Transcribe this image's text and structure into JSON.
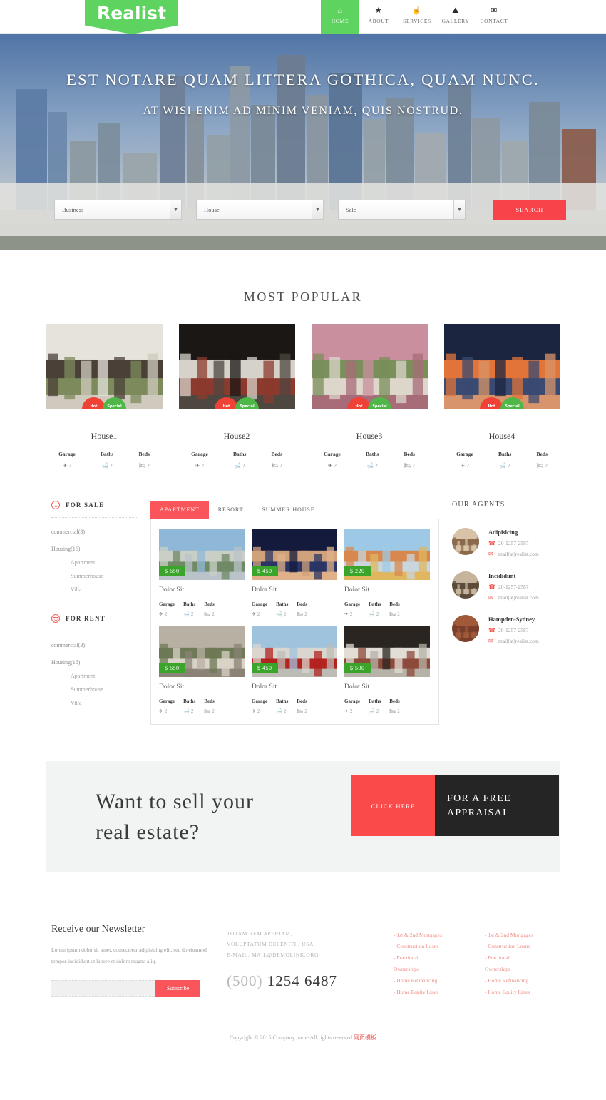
{
  "brand": {
    "name": "Realist",
    "color": "#5fd35f"
  },
  "nav": {
    "items": [
      {
        "label": "HOME",
        "icon": "home-icon",
        "glyph": "⌂",
        "active": true
      },
      {
        "label": "ABOUT",
        "icon": "star-icon",
        "glyph": "★",
        "active": false
      },
      {
        "label": "SERVICES",
        "icon": "thumbs-up-icon",
        "glyph": "☝",
        "active": false
      },
      {
        "label": "GALLERY",
        "icon": "image-icon",
        "glyph": "⛰",
        "active": false
      },
      {
        "label": "CONTACT",
        "icon": "envelope-icon",
        "glyph": "✉",
        "active": false
      }
    ]
  },
  "hero": {
    "title": "EST NOTARE QUAM LITTERA GOTHICA, QUAM NUNC.",
    "subtitle": "AT WISI ENIM AD MINIM VENIAM, QUIS NOSTRUD."
  },
  "search": {
    "type_value": "Business",
    "property_value": "House",
    "deal_value": "Sale",
    "button_label": "SEARCH"
  },
  "popular": {
    "title": "MOST POPULAR",
    "badge_hot": "Hot Offer",
    "badge_special": "Special Offer",
    "cards": [
      {
        "title": "House1",
        "garage": "2",
        "baths": "2",
        "beds": "2"
      },
      {
        "title": "House2",
        "garage": "2",
        "baths": "2",
        "beds": "2"
      },
      {
        "title": "House3",
        "garage": "2",
        "baths": "2",
        "beds": "2"
      },
      {
        "title": "House4",
        "garage": "2",
        "baths": "2",
        "beds": "2"
      }
    ],
    "labels": {
      "garage": "Garage",
      "baths": "Baths",
      "beds": "Beds"
    }
  },
  "sidebar": {
    "blocks": [
      {
        "title": "FOR SALE",
        "links": [
          {
            "label": "commercial(3)",
            "sub": false
          },
          {
            "label": "Housing(16)",
            "sub": false
          },
          {
            "label": "Apartment",
            "sub": true
          },
          {
            "label": "Summerhouse",
            "sub": true
          },
          {
            "label": "Villa",
            "sub": true
          }
        ]
      },
      {
        "title": "FOR RENT",
        "links": [
          {
            "label": "commercial(3)",
            "sub": false
          },
          {
            "label": "Housing(16)",
            "sub": false
          },
          {
            "label": "Apartment",
            "sub": true
          },
          {
            "label": "Summerhouse",
            "sub": true
          },
          {
            "label": "Villa",
            "sub": true
          }
        ]
      }
    ]
  },
  "listings": {
    "tabs": [
      {
        "label": "APARTMENT",
        "active": true
      },
      {
        "label": "RESORT",
        "active": false
      },
      {
        "label": "SUMMER HOUSE",
        "active": false
      }
    ],
    "labels": {
      "garage": "Garage",
      "baths": "Baths",
      "beds": "Beds"
    },
    "cards": [
      {
        "price": "$ 650",
        "title": "Dolor Sit",
        "garage": "2",
        "baths": "2",
        "beds": "2",
        "img": "harbor-city"
      },
      {
        "price": "$ 450",
        "title": "Dolor Sit",
        "garage": "2",
        "baths": "2",
        "beds": "2",
        "img": "bridge-night"
      },
      {
        "price": "$ 220",
        "title": "Dolor Sit",
        "garage": "2",
        "baths": "2",
        "beds": "2",
        "img": "waterfront-town"
      },
      {
        "price": "$ 650",
        "title": "Dolor Sit",
        "garage": "2",
        "baths": "2",
        "beds": "2",
        "img": "townhouse-row"
      },
      {
        "price": "$ 450",
        "title": "Dolor Sit",
        "garage": "2",
        "baths": "2",
        "beds": "2",
        "img": "city-street"
      },
      {
        "price": "$ 500",
        "title": "Dolor Sit",
        "garage": "2",
        "baths": "2",
        "beds": "2",
        "img": "tudor-house"
      }
    ]
  },
  "agents": {
    "title": "OUR AGENTS",
    "items": [
      {
        "name": "Adipisicing",
        "phone": "20-1257-2587",
        "email": "mail(at)realist.com"
      },
      {
        "name": "Incididunt",
        "phone": "20-1257-2587",
        "email": "mail(at)realist.com"
      },
      {
        "name": "Hampden-Sydney",
        "phone": "20-1257-2587",
        "email": "mail(at)realist.com"
      }
    ]
  },
  "cta": {
    "text": "Want to sell your real estate?",
    "button_label": "CLICK HERE",
    "dark_label": "FOR A FREE APPRAISAL"
  },
  "newsletter": {
    "title": "Receive our Newsletter",
    "text": "Lorem ipsum dolor sit amet, consectetur adipisicing elit, sed do eiusmod tempor incididunt ut labore et dolore magna aliq.",
    "input_placeholder": "",
    "input_value": "",
    "button_label": "Subscribe"
  },
  "contact": {
    "address_line1": "TOTAM REM APERIAM,",
    "address_line2": "VOLUPTATUM DELENITI , USA",
    "email_line": "E-MAIL: MAIL@DEMOLINK.ORG",
    "phone_code": "(500)",
    "phone_number": "1254 6487"
  },
  "footer_links": {
    "columns": [
      {
        "items": [
          "- 1st & 2nd Mortgages",
          "- Construction Loans",
          "- Fractional",
          "  Ownerships",
          "- Home Refinancing",
          "- Home Equity Lines"
        ]
      },
      {
        "items": [
          "- 1st & 2nd Mortgages",
          "- Construction Loans",
          "- Fractional",
          "  Ownerships",
          "- Home Refinancing",
          "- Home Equity Lines"
        ]
      }
    ]
  },
  "copyright": {
    "text": "Copyright © 2015.Company name All rights reserved.",
    "cn": "网页模板"
  }
}
